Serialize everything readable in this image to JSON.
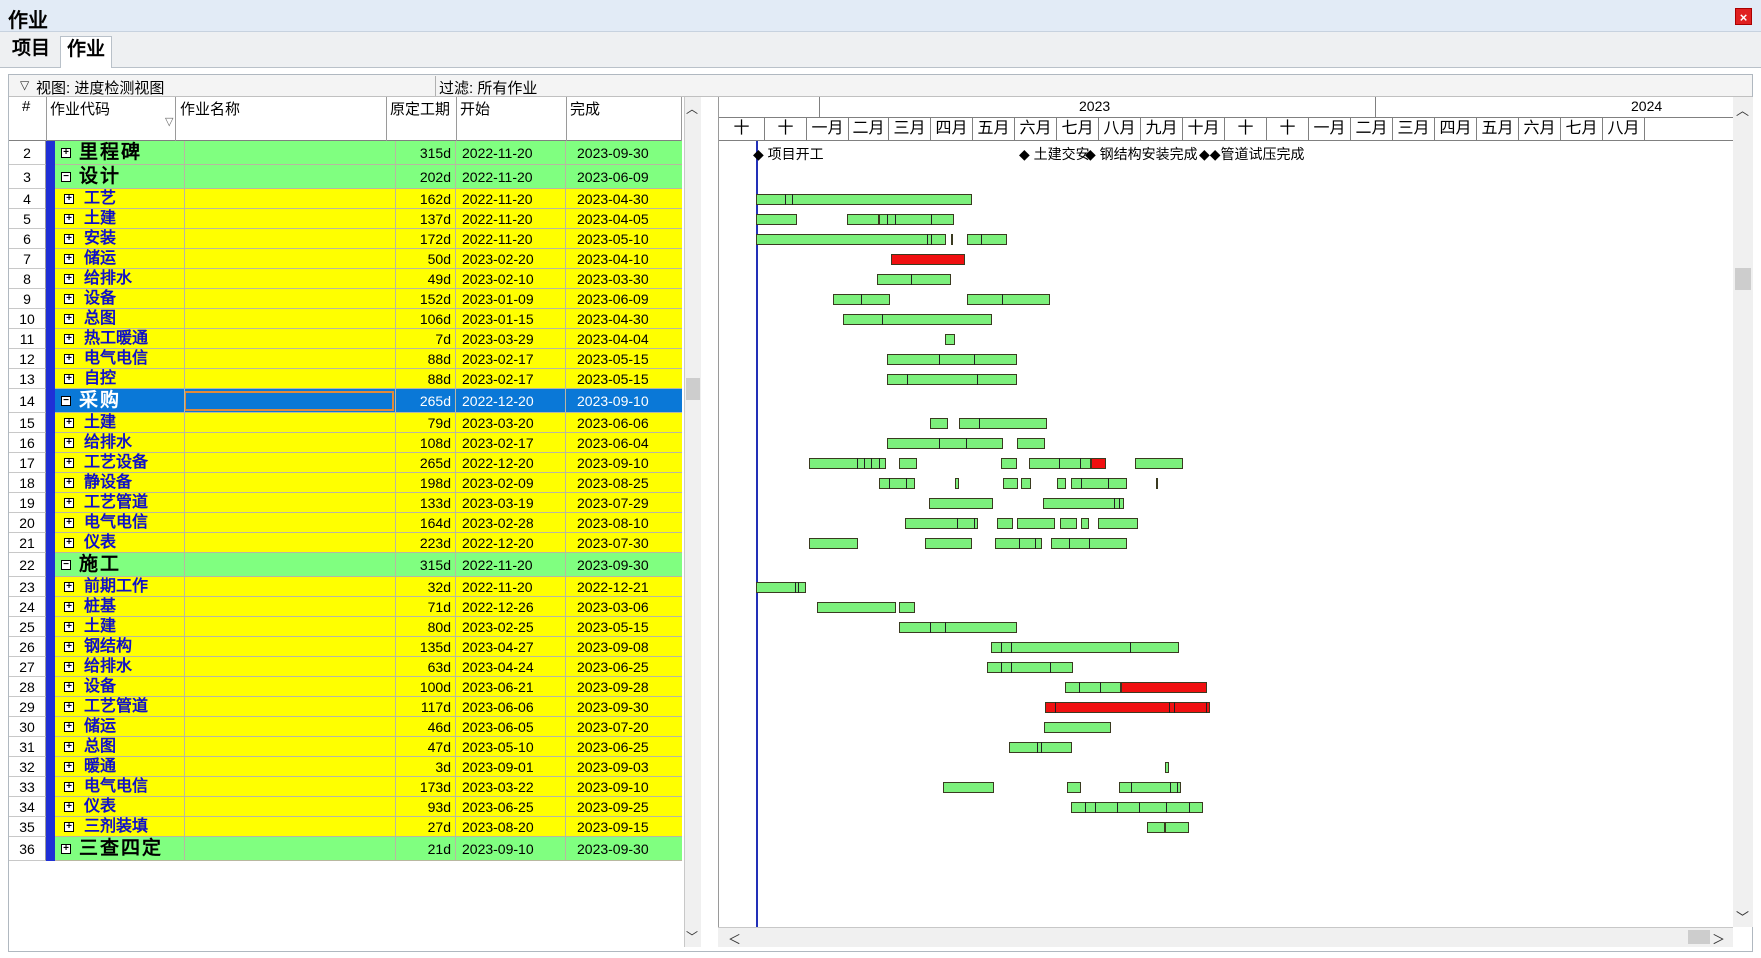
{
  "window": {
    "title": "作业",
    "close_glyph": "×"
  },
  "tabs": [
    {
      "label": "项目"
    },
    {
      "label": "作业"
    }
  ],
  "viewbar": {
    "view": "视图: 进度检测视图",
    "filter": "过滤: 所有作业"
  },
  "columns": {
    "num": "#",
    "code": "作业代码",
    "name": "作业名称",
    "duration": "原定工期",
    "start": "开始",
    "finish": "完成"
  },
  "rows": [
    {
      "n": "2",
      "level": 1,
      "name": "里程碑",
      "dur": "315d",
      "start": "2022-11-20",
      "finish": "2023-09-30",
      "collapsed": true
    },
    {
      "n": "3",
      "level": 1,
      "name": "设计",
      "dur": "202d",
      "start": "2022-11-20",
      "finish": "2023-06-09",
      "collapsed": false
    },
    {
      "n": "4",
      "level": 2,
      "name": "工艺",
      "dur": "162d",
      "start": "2022-11-20",
      "finish": "2023-04-30"
    },
    {
      "n": "5",
      "level": 2,
      "name": "土建",
      "dur": "137d",
      "start": "2022-11-20",
      "finish": "2023-04-05"
    },
    {
      "n": "6",
      "level": 2,
      "name": "安装",
      "dur": "172d",
      "start": "2022-11-20",
      "finish": "2023-05-10"
    },
    {
      "n": "7",
      "level": 2,
      "name": "储运",
      "dur": "50d",
      "start": "2023-02-20",
      "finish": "2023-04-10"
    },
    {
      "n": "8",
      "level": 2,
      "name": "给排水",
      "dur": "49d",
      "start": "2023-02-10",
      "finish": "2023-03-30"
    },
    {
      "n": "9",
      "level": 2,
      "name": "设备",
      "dur": "152d",
      "start": "2023-01-09",
      "finish": "2023-06-09"
    },
    {
      "n": "10",
      "level": 2,
      "name": "总图",
      "dur": "106d",
      "start": "2023-01-15",
      "finish": "2023-04-30"
    },
    {
      "n": "11",
      "level": 2,
      "name": "热工暖通",
      "dur": "7d",
      "start": "2023-03-29",
      "finish": "2023-04-04"
    },
    {
      "n": "12",
      "level": 2,
      "name": "电气电信",
      "dur": "88d",
      "start": "2023-02-17",
      "finish": "2023-05-15"
    },
    {
      "n": "13",
      "level": 2,
      "name": "自控",
      "dur": "88d",
      "start": "2023-02-17",
      "finish": "2023-05-15"
    },
    {
      "n": "14",
      "level": 1,
      "name": "采购",
      "dur": "265d",
      "start": "2022-12-20",
      "finish": "2023-09-10",
      "collapsed": false,
      "selected": true
    },
    {
      "n": "15",
      "level": 2,
      "name": "土建",
      "dur": "79d",
      "start": "2023-03-20",
      "finish": "2023-06-06"
    },
    {
      "n": "16",
      "level": 2,
      "name": "给排水",
      "dur": "108d",
      "start": "2023-02-17",
      "finish": "2023-06-04"
    },
    {
      "n": "17",
      "level": 2,
      "name": "工艺设备",
      "dur": "265d",
      "start": "2022-12-20",
      "finish": "2023-09-10"
    },
    {
      "n": "18",
      "level": 2,
      "name": "静设备",
      "dur": "198d",
      "start": "2023-02-09",
      "finish": "2023-08-25"
    },
    {
      "n": "19",
      "level": 2,
      "name": "工艺管道",
      "dur": "133d",
      "start": "2023-03-19",
      "finish": "2023-07-29"
    },
    {
      "n": "20",
      "level": 2,
      "name": "电气电信",
      "dur": "164d",
      "start": "2023-02-28",
      "finish": "2023-08-10"
    },
    {
      "n": "21",
      "level": 2,
      "name": "仪表",
      "dur": "223d",
      "start": "2022-12-20",
      "finish": "2023-07-30"
    },
    {
      "n": "22",
      "level": 1,
      "name": "施工",
      "dur": "315d",
      "start": "2022-11-20",
      "finish": "2023-09-30",
      "collapsed": false
    },
    {
      "n": "23",
      "level": 2,
      "name": "前期工作",
      "dur": "32d",
      "start": "2022-11-20",
      "finish": "2022-12-21"
    },
    {
      "n": "24",
      "level": 2,
      "name": "桩基",
      "dur": "71d",
      "start": "2022-12-26",
      "finish": "2023-03-06"
    },
    {
      "n": "25",
      "level": 2,
      "name": "土建",
      "dur": "80d",
      "start": "2023-02-25",
      "finish": "2023-05-15"
    },
    {
      "n": "26",
      "level": 2,
      "name": "钢结构",
      "dur": "135d",
      "start": "2023-04-27",
      "finish": "2023-09-08"
    },
    {
      "n": "27",
      "level": 2,
      "name": "给排水",
      "dur": "63d",
      "start": "2023-04-24",
      "finish": "2023-06-25"
    },
    {
      "n": "28",
      "level": 2,
      "name": "设备",
      "dur": "100d",
      "start": "2023-06-21",
      "finish": "2023-09-28"
    },
    {
      "n": "29",
      "level": 2,
      "name": "工艺管道",
      "dur": "117d",
      "start": "2023-06-06",
      "finish": "2023-09-30"
    },
    {
      "n": "30",
      "level": 2,
      "name": "储运",
      "dur": "46d",
      "start": "2023-06-05",
      "finish": "2023-07-20"
    },
    {
      "n": "31",
      "level": 2,
      "name": "总图",
      "dur": "47d",
      "start": "2023-05-10",
      "finish": "2023-06-25"
    },
    {
      "n": "32",
      "level": 2,
      "name": "暖通",
      "dur": "3d",
      "start": "2023-09-01",
      "finish": "2023-09-03"
    },
    {
      "n": "33",
      "level": 2,
      "name": "电气电信",
      "dur": "173d",
      "start": "2023-03-22",
      "finish": "2023-09-10"
    },
    {
      "n": "34",
      "level": 2,
      "name": "仪表",
      "dur": "93d",
      "start": "2023-06-25",
      "finish": "2023-09-25"
    },
    {
      "n": "35",
      "level": 2,
      "name": "三剂装填",
      "dur": "27d",
      "start": "2023-08-20",
      "finish": "2023-09-15"
    },
    {
      "n": "36",
      "level": 1,
      "name": "三查四定",
      "dur": "21d",
      "start": "2023-09-10",
      "finish": "2023-09-30",
      "collapsed": true
    }
  ],
  "gantt": {
    "years": [
      "2023",
      "2024"
    ],
    "months": [
      "十",
      "十",
      "一月",
      "二月",
      "三月",
      "四月",
      "五月",
      "六月",
      "七月",
      "八月",
      "九月",
      "十月",
      "十",
      "十",
      "一月",
      "二月",
      "三月",
      "四月",
      "五月",
      "六月",
      "七月",
      "八月"
    ],
    "milestone_labels": [
      "项目开工",
      "土建交安",
      "钢结构安装完成",
      "管道试压完成"
    ],
    "milestone_glyph": "◆"
  },
  "colors": {
    "level1": "#80ff80",
    "level2": "#ffff00",
    "selected": "#0a78d7",
    "progress_bar": "#7cf07c",
    "critical_bar": "#f01010",
    "level_marker": "#1f2fd6",
    "milestone_text": "#000000"
  },
  "icons": {
    "expand": "plus-box-icon",
    "collapse": "minus-box-icon",
    "close": "close-icon",
    "view-menu": "chevron-down-icon",
    "scroll": "arrow-icon"
  }
}
